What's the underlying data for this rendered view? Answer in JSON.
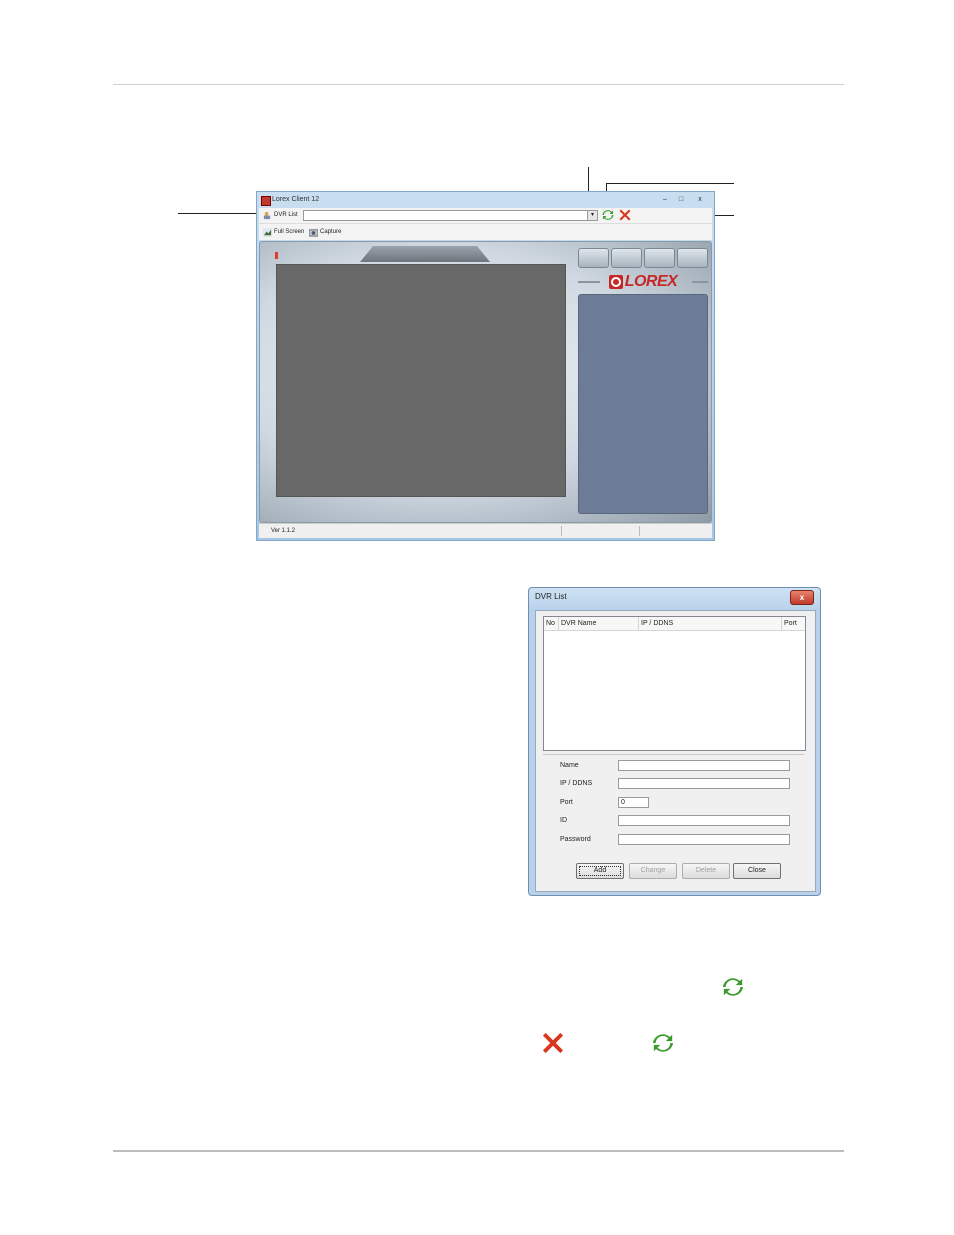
{
  "client_window": {
    "title": "Lorex Client 12",
    "caption_buttons": {
      "minimize": "–",
      "maximize": "□",
      "close": "x"
    },
    "toolbar": {
      "dvr_list_label": "DVR List",
      "combo_value": "",
      "combo_arrow": "▾",
      "full_screen_label": "Full Screen",
      "capture_label": "Capture"
    },
    "logo_text": "LOREX",
    "status_version": "Ver 1.1.2"
  },
  "dvr_list_dialog": {
    "title": "DVR List",
    "close_glyph": "x",
    "columns": [
      "No",
      "DVR Name",
      "IP / DDNS",
      "Port"
    ],
    "fields": {
      "name_label": "Name",
      "ip_label": "IP / DDNS",
      "port_label": "Port",
      "port_value": "0",
      "id_label": "ID",
      "password_label": "Password"
    },
    "buttons": {
      "add": "Add",
      "change": "Change",
      "delete": "Delete",
      "close": "Close"
    }
  },
  "icons": {
    "refresh": "refresh-icon",
    "delete": "delete-x-icon",
    "accent_green": "#3c9a2e",
    "accent_red": "#d9381e"
  }
}
